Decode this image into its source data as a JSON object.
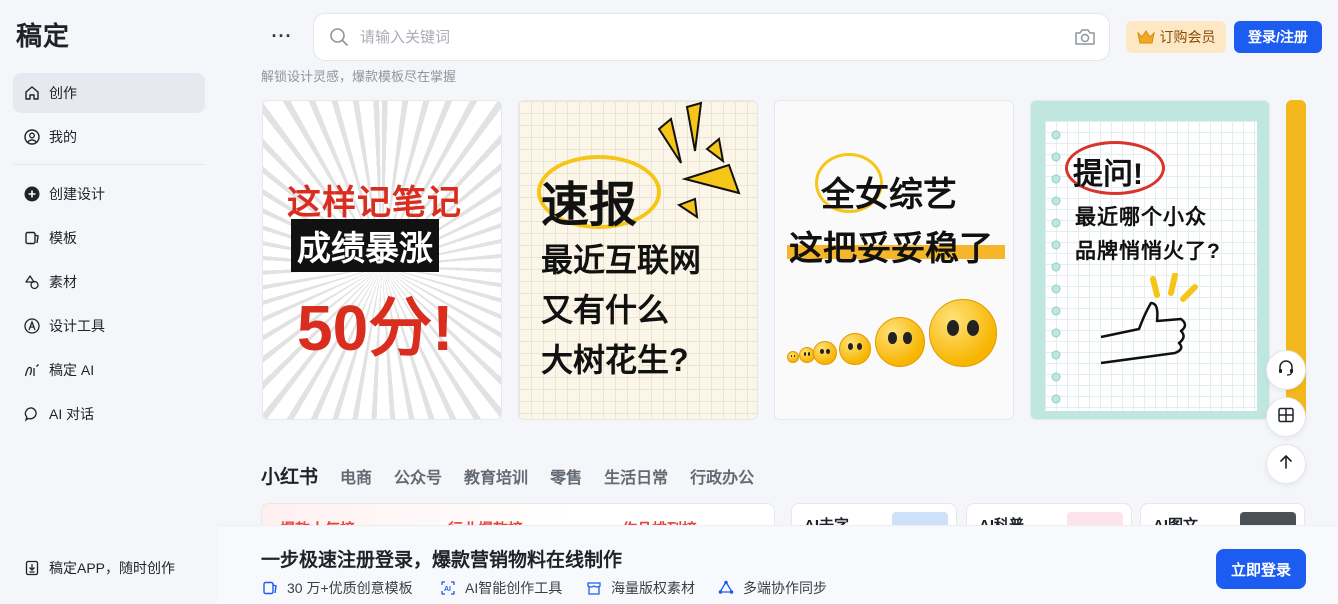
{
  "app": {
    "logo": "稿定"
  },
  "sidebar": {
    "items": [
      {
        "label": "创作",
        "icon": "home-icon",
        "active": true
      },
      {
        "label": "我的",
        "icon": "user-icon"
      },
      {
        "label": "创建设计",
        "icon": "plus-circle-icon"
      },
      {
        "label": "模板",
        "icon": "template-icon"
      },
      {
        "label": "素材",
        "icon": "shapes-icon"
      },
      {
        "label": "设计工具",
        "icon": "tool-icon"
      },
      {
        "label": "稿定 AI",
        "icon": "ai-icon"
      },
      {
        "label": "AI 对话",
        "icon": "chat-icon"
      }
    ],
    "app_link": "稿定APP，随时创作"
  },
  "header": {
    "more": "···",
    "search_placeholder": "请输入关键词",
    "vip_label": "订购会员",
    "login_label": "登录/注册",
    "tagline": "解锁设计灵感，爆款模板尽在掌握"
  },
  "cards": [
    {
      "lines": [
        "这样记笔记",
        "成绩暴涨",
        "50分!"
      ]
    },
    {
      "lines": [
        "速报",
        "最近互联网",
        "又有什么",
        "大树花生?"
      ]
    },
    {
      "lines": [
        "全女综艺",
        "这把妥妥稳了"
      ]
    },
    {
      "lines": [
        "提问!",
        "最近哪个小众",
        "品牌悄悄火了?"
      ]
    }
  ],
  "category_tabs": [
    "小红书",
    "电商",
    "公众号",
    "教育培训",
    "零售",
    "生活日常",
    "行政办公"
  ],
  "sub_cards": {
    "pink_labels": [
      "爆款人气榜",
      "行业爆款榜",
      "作品排列榜"
    ],
    "small_labels": [
      "AI去字",
      "AI科普",
      "AI图文"
    ]
  },
  "banner": {
    "title": "一步极速注册登录，爆款营销物料在线制作",
    "features": [
      "30 万+优质创意模板",
      "AI智能创作工具",
      "海量版权素材",
      "多端协作同步"
    ],
    "button": "立即登录"
  },
  "colors": {
    "accent": "#1c5cf0",
    "vip_bg": "#fde8c6",
    "highlight_red": "#d92d20",
    "yellow": "#f5c518"
  }
}
